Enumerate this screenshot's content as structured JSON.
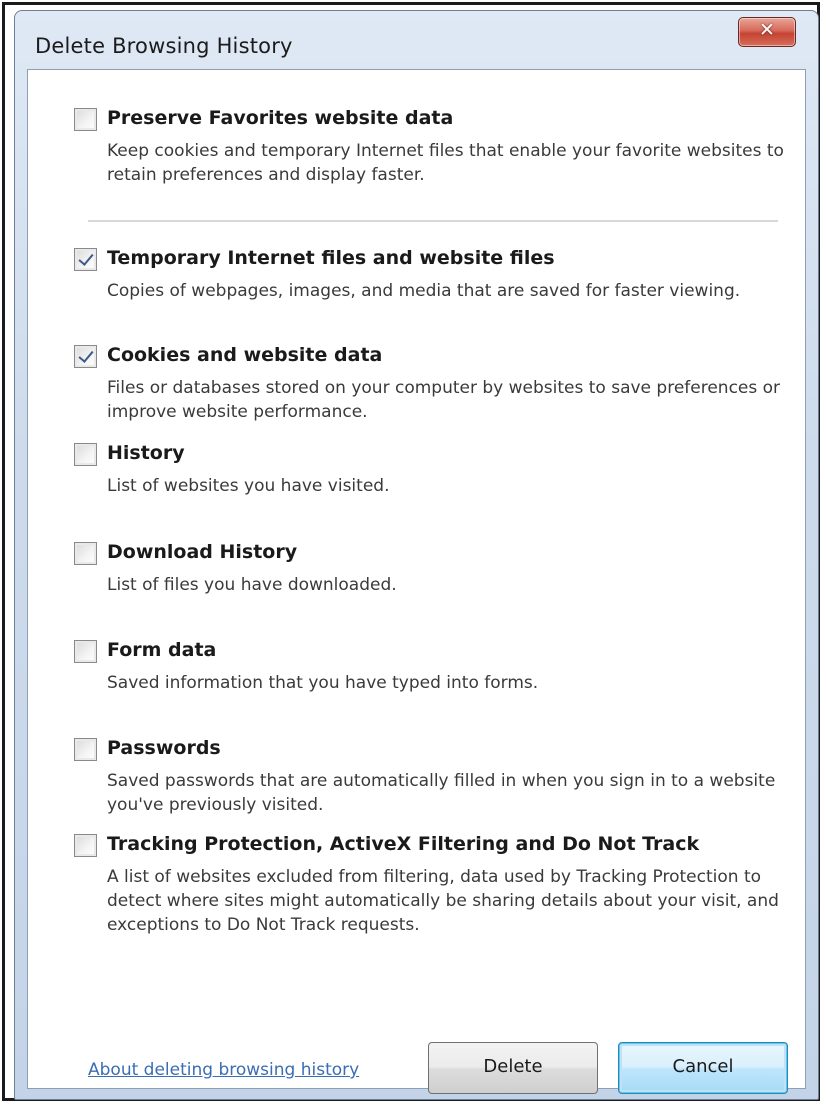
{
  "window": {
    "title": "Delete Browsing History",
    "close_glyph": "✕"
  },
  "options": [
    {
      "title": "Preserve Favorites website data",
      "description": "Keep cookies and temporary Internet files that enable your favorite websites to retain preferences and display faster.",
      "checked": false
    },
    {
      "title": "Temporary Internet files and website files",
      "description": "Copies of webpages, images, and media that are saved for faster viewing.",
      "checked": true
    },
    {
      "title": "Cookies and website data",
      "description": "Files or databases stored on your computer by websites to save preferences or improve website performance.",
      "checked": true
    },
    {
      "title": "History",
      "description": "List of websites you have visited.",
      "checked": false
    },
    {
      "title": "Download History",
      "description": "List of files you have downloaded.",
      "checked": false
    },
    {
      "title": "Form data",
      "description": "Saved information that you have typed into forms.",
      "checked": false
    },
    {
      "title": "Passwords",
      "description": "Saved passwords that are automatically filled in when you sign in to a website you've previously visited.",
      "checked": false
    },
    {
      "title": "Tracking Protection, ActiveX Filtering and Do Not Track",
      "description": "A list of websites excluded from filtering, data used by Tracking Protection to detect where sites might automatically be sharing details about your visit, and exceptions to Do Not Track requests.",
      "checked": false
    }
  ],
  "footer": {
    "help_link": "About deleting browsing history",
    "delete_label": "Delete",
    "cancel_label": "Cancel"
  },
  "icons": {
    "close": "close-icon",
    "checkmark": "checkmark-icon"
  }
}
